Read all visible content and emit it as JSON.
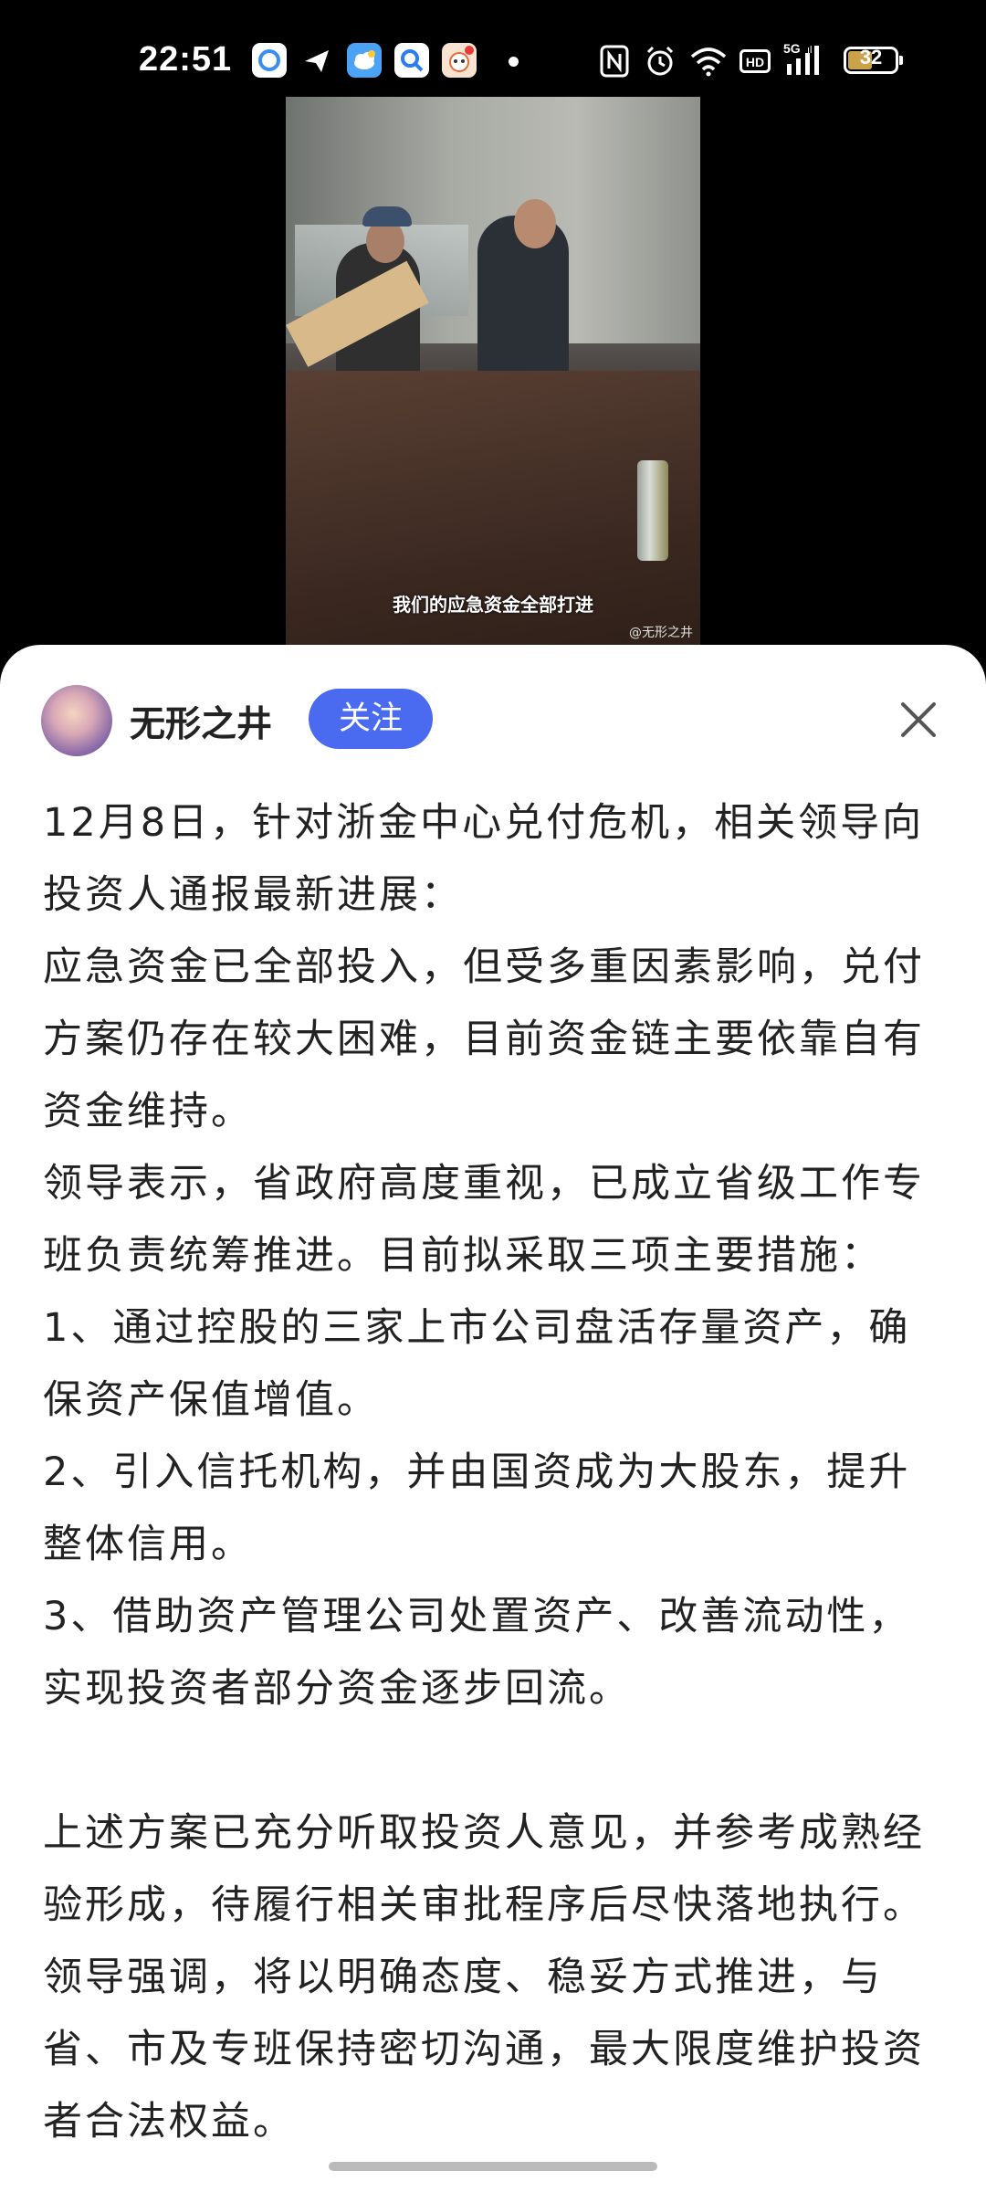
{
  "status_bar": {
    "time": "22:51",
    "battery": "32",
    "icons": [
      "nfc-icon",
      "alarm-icon",
      "wifi-icon",
      "hd-icon",
      "5g-signal-icon",
      "battery-icon"
    ],
    "app_icons": [
      "browser-app-icon",
      "messenger-app-icon",
      "cloud-app-icon",
      "search-app-icon",
      "cartoon-app-icon"
    ]
  },
  "video": {
    "subtitle": "我们的应急资金全部打进",
    "watermark": "@无形之井"
  },
  "post": {
    "author": "无形之井",
    "follow_label": "关注",
    "paragraphs": [
      "12月8日，针对浙金中心兑付危机，相关领导向投资人通报最新进展：",
      "应急资金已全部投入，但受多重因素影响，兑付方案仍存在较大困难，目前资金链主要依靠自有资金维持。",
      "领导表示，省政府高度重视，已成立省级工作专班负责统筹推进。目前拟采取三项主要措施：",
      "1、通过控股的三家上市公司盘活存量资产，确保资产保值增值。",
      "2、引入信托机构，并由国资成为大股东，提升整体信用。",
      "3、借助资产管理公司处置资产、改善流动性，实现投资者部分资金逐步回流。",
      "上述方案已充分听取投资人意见，并参考成熟经验形成，待履行相关审批程序后尽快落地执行。领导强调，将以明确态度、稳妥方式推进，与省、市及专班保持密切沟通，最大限度维护投资者合法权益。"
    ]
  }
}
